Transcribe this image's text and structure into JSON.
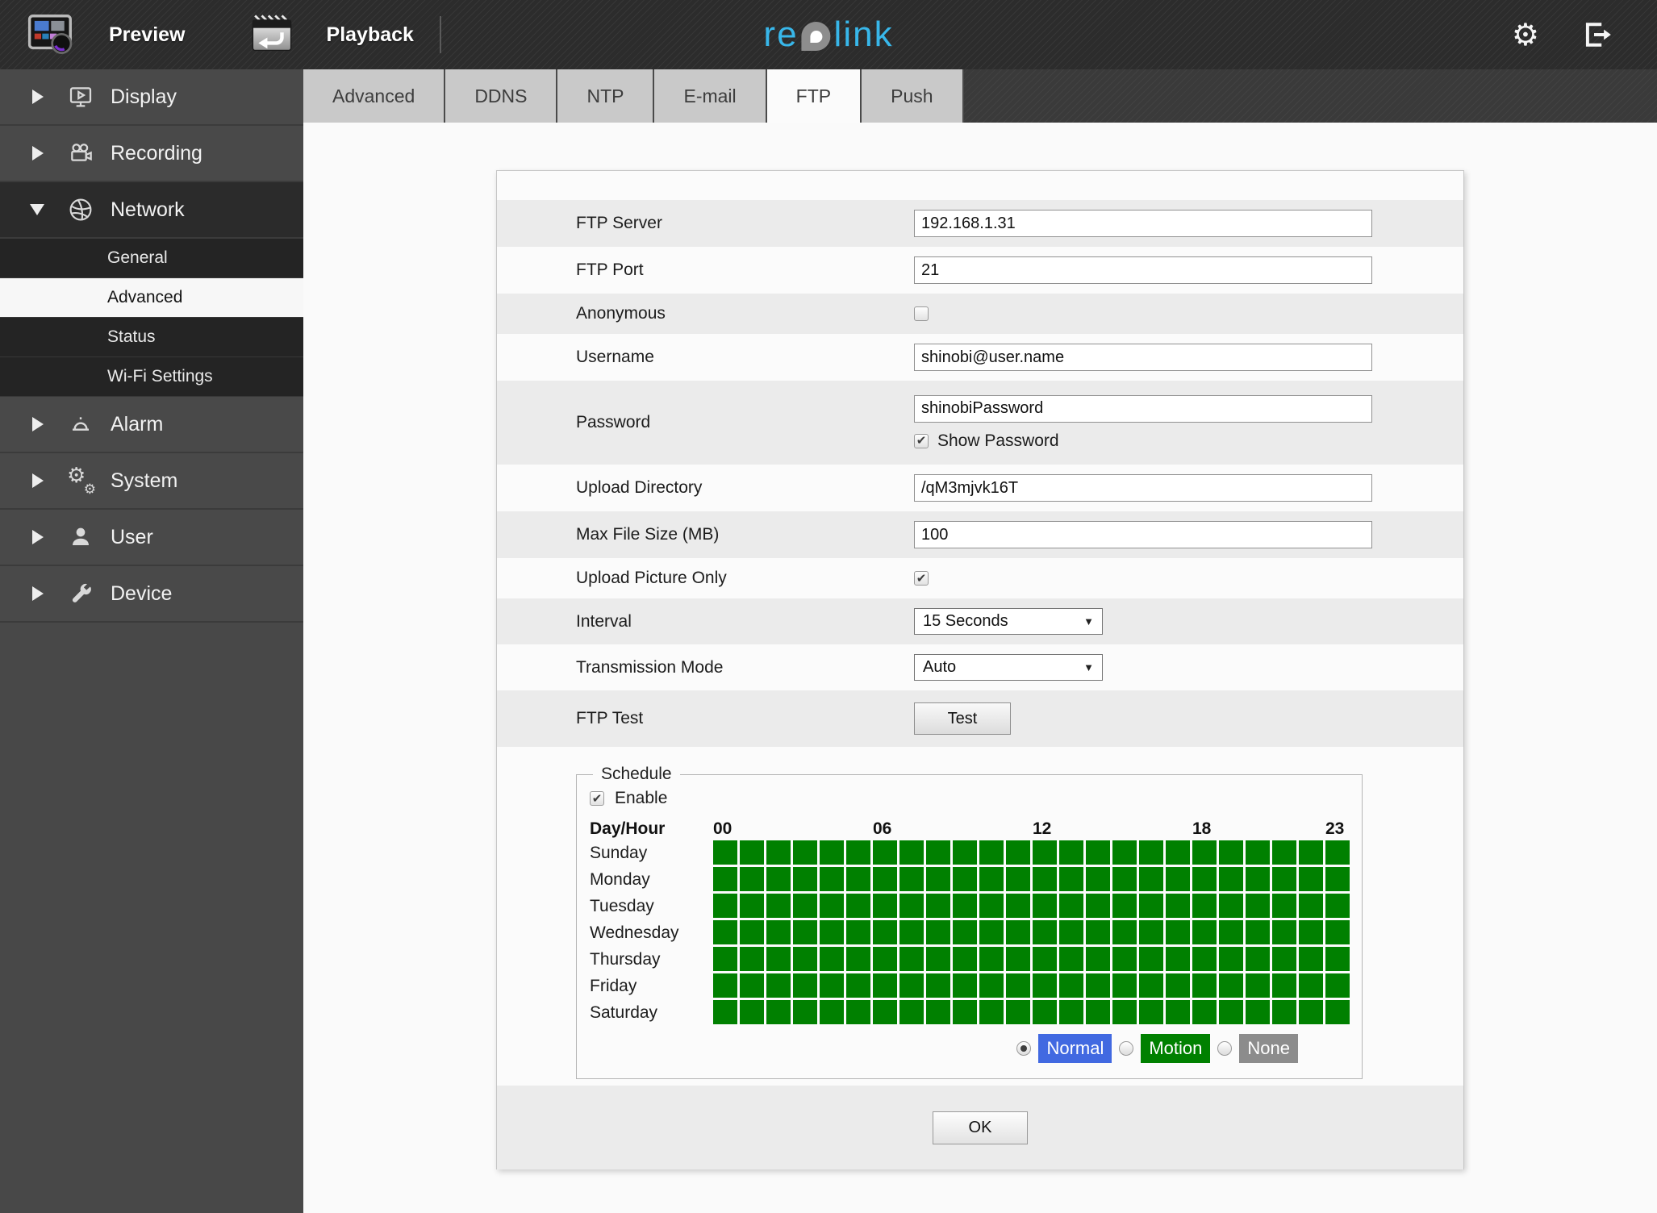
{
  "topbar": {
    "preview_label": "Preview",
    "playback_label": "Playback",
    "logo_re": "re",
    "logo_link": "link"
  },
  "sidebar": {
    "items": [
      {
        "label": "Display",
        "icon": "monitor-play-icon",
        "expanded": false
      },
      {
        "label": "Recording",
        "icon": "video-camera-icon",
        "expanded": false
      },
      {
        "label": "Network",
        "icon": "globe-icon",
        "expanded": true,
        "children": [
          {
            "label": "General",
            "selected": false
          },
          {
            "label": "Advanced",
            "selected": true
          },
          {
            "label": "Status",
            "selected": false
          },
          {
            "label": "Wi-Fi Settings",
            "selected": false
          }
        ]
      },
      {
        "label": "Alarm",
        "icon": "siren-icon",
        "expanded": false
      },
      {
        "label": "System",
        "icon": "gears-icon",
        "expanded": false
      },
      {
        "label": "User",
        "icon": "person-icon",
        "expanded": false
      },
      {
        "label": "Device",
        "icon": "wrench-icon",
        "expanded": false
      }
    ]
  },
  "tabs": {
    "items": [
      "Advanced",
      "DDNS",
      "NTP",
      "E-mail",
      "FTP",
      "Push"
    ],
    "active": "FTP"
  },
  "form": {
    "rows": [
      {
        "label": "FTP Server",
        "type": "text",
        "value": "192.168.1.31"
      },
      {
        "label": "FTP Port",
        "type": "text",
        "value": "21"
      },
      {
        "label": "Anonymous",
        "type": "checkbox",
        "checked": false
      },
      {
        "label": "Username",
        "type": "text",
        "value": "shinobi@user.name"
      },
      {
        "label": "Password",
        "type": "password",
        "value": "shinobiPassword",
        "extra": {
          "type": "checkbox",
          "checked": true,
          "label": "Show Password"
        }
      },
      {
        "label": "Upload Directory",
        "type": "text",
        "value": "/qM3mjvk16T"
      },
      {
        "label": "Max File Size (MB)",
        "type": "text",
        "value": "100"
      },
      {
        "label": "Upload Picture Only",
        "type": "checkbox",
        "checked": true
      },
      {
        "label": "Interval",
        "type": "select",
        "value": "15 Seconds"
      },
      {
        "label": "Transmission Mode",
        "type": "select",
        "value": "Auto"
      },
      {
        "label": "FTP Test",
        "type": "button",
        "value": "Test"
      }
    ]
  },
  "schedule": {
    "legend": "Schedule",
    "enable_label": "Enable",
    "enabled": true,
    "header": "Day/Hour",
    "hours": [
      {
        "label": "00",
        "col": 0
      },
      {
        "label": "06",
        "col": 6
      },
      {
        "label": "12",
        "col": 12
      },
      {
        "label": "18",
        "col": 18
      },
      {
        "label": "23",
        "col": 23
      }
    ],
    "days": [
      "Sunday",
      "Monday",
      "Tuesday",
      "Wednesday",
      "Thursday",
      "Friday",
      "Saturday"
    ],
    "columns": 24,
    "all_cells_state": "motion",
    "modes": [
      {
        "label": "Normal",
        "color": "#4169e1",
        "selected": true
      },
      {
        "label": "Motion",
        "color": "#008000",
        "selected": false
      },
      {
        "label": "None",
        "color": "#8c8c8c",
        "selected": false
      }
    ]
  },
  "ok_label": "OK",
  "colors": {
    "accent_blue": "#4169e1",
    "schedule_green": "#008000",
    "chip_gray": "#8c8c8c",
    "logo_cyan": "#38b7ea",
    "row_gray": "#ebebeb"
  }
}
